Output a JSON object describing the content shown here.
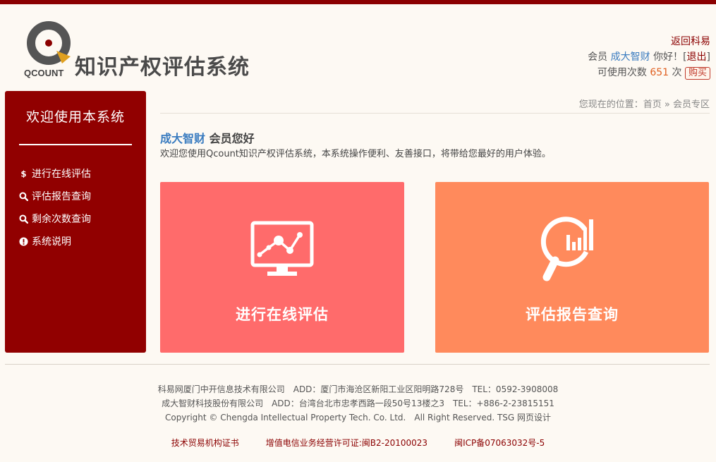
{
  "header": {
    "logo_text": "QCOUNT",
    "title": "知识产权评估系统",
    "back_link": "返回科易",
    "member_prefix": "会员",
    "username": "成大智财",
    "greeting_suffix": "你好！",
    "logout_open": "[",
    "logout_label": "退出",
    "logout_close": "]",
    "usage_label": "可使用次数",
    "usage_count": "651",
    "usage_unit": "次",
    "buy_label": "购买"
  },
  "sidebar": {
    "title": "欢迎使用本系统",
    "items": [
      {
        "label": "进行在线评估",
        "icon": "dollar-icon"
      },
      {
        "label": "评估报告查询",
        "icon": "search-icon"
      },
      {
        "label": "剩余次数查询",
        "icon": "search-icon"
      },
      {
        "label": "系统说明",
        "icon": "info-icon"
      }
    ]
  },
  "breadcrumb": {
    "text": "您现在的位置：首页 » 会员专区"
  },
  "welcome": {
    "username": "成大智财",
    "title_suffix": " 会员您好",
    "text": "欢迎您使用Qcount知识产权评估系统，本系统操作便利、友善接口，将带给您最好的用户体验。"
  },
  "cards": [
    {
      "label": "进行在线评估",
      "icon": "monitor-chart-icon",
      "color": "#ff6b6b"
    },
    {
      "label": "评估报告查询",
      "icon": "magnifier-chart-icon",
      "color": "#ff8a5c"
    }
  ],
  "footer": {
    "line1": "科易网厦门中开信息技术有限公司　ADD：厦门市海沧区新阳工业区阳明路728号　TEL：0592-3908008",
    "line2": "成大智财科技股份有限公司　ADD：台湾台北市忠孝西路一段50号13楼之3　TEL：+886-2-23815151",
    "line3": "Copyright © Chengda Intellectual Property Tech. Co. Ltd.　All Right Reserved. TSG 网页设计",
    "links": [
      "技术贸易机构证书",
      "增值电信业务经营许可证:闽B2-20100023",
      "闽ICP备07063032号-5"
    ]
  },
  "colors": {
    "brand": "#8b0000",
    "sidebar": "#910000",
    "accent_blue": "#3a7cc0",
    "count": "#e06020"
  }
}
